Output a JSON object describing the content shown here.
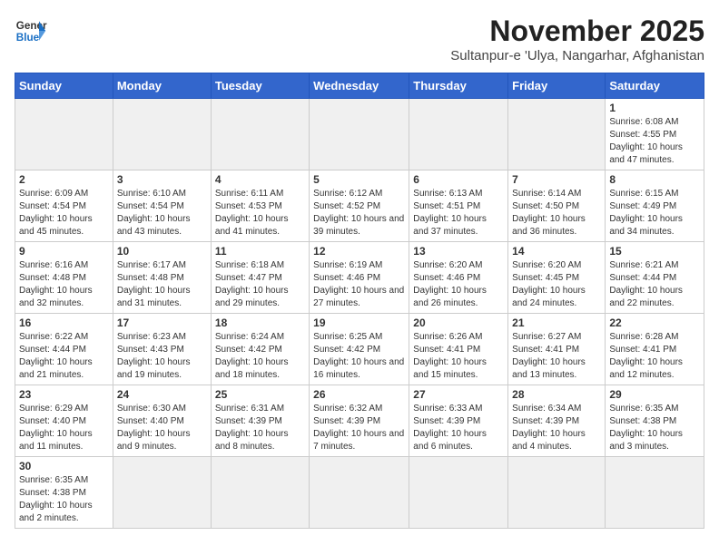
{
  "header": {
    "logo_line1": "General",
    "logo_line2": "Blue",
    "title": "November 2025",
    "subtitle": "Sultanpur-e 'Ulya, Nangarhar, Afghanistan"
  },
  "weekdays": [
    "Sunday",
    "Monday",
    "Tuesday",
    "Wednesday",
    "Thursday",
    "Friday",
    "Saturday"
  ],
  "weeks": [
    [
      {
        "day": "",
        "info": ""
      },
      {
        "day": "",
        "info": ""
      },
      {
        "day": "",
        "info": ""
      },
      {
        "day": "",
        "info": ""
      },
      {
        "day": "",
        "info": ""
      },
      {
        "day": "",
        "info": ""
      },
      {
        "day": "1",
        "info": "Sunrise: 6:08 AM\nSunset: 4:55 PM\nDaylight: 10 hours and 47 minutes."
      }
    ],
    [
      {
        "day": "2",
        "info": "Sunrise: 6:09 AM\nSunset: 4:54 PM\nDaylight: 10 hours and 45 minutes."
      },
      {
        "day": "3",
        "info": "Sunrise: 6:10 AM\nSunset: 4:54 PM\nDaylight: 10 hours and 43 minutes."
      },
      {
        "day": "4",
        "info": "Sunrise: 6:11 AM\nSunset: 4:53 PM\nDaylight: 10 hours and 41 minutes."
      },
      {
        "day": "5",
        "info": "Sunrise: 6:12 AM\nSunset: 4:52 PM\nDaylight: 10 hours and 39 minutes."
      },
      {
        "day": "6",
        "info": "Sunrise: 6:13 AM\nSunset: 4:51 PM\nDaylight: 10 hours and 37 minutes."
      },
      {
        "day": "7",
        "info": "Sunrise: 6:14 AM\nSunset: 4:50 PM\nDaylight: 10 hours and 36 minutes."
      },
      {
        "day": "8",
        "info": "Sunrise: 6:15 AM\nSunset: 4:49 PM\nDaylight: 10 hours and 34 minutes."
      }
    ],
    [
      {
        "day": "9",
        "info": "Sunrise: 6:16 AM\nSunset: 4:48 PM\nDaylight: 10 hours and 32 minutes."
      },
      {
        "day": "10",
        "info": "Sunrise: 6:17 AM\nSunset: 4:48 PM\nDaylight: 10 hours and 31 minutes."
      },
      {
        "day": "11",
        "info": "Sunrise: 6:18 AM\nSunset: 4:47 PM\nDaylight: 10 hours and 29 minutes."
      },
      {
        "day": "12",
        "info": "Sunrise: 6:19 AM\nSunset: 4:46 PM\nDaylight: 10 hours and 27 minutes."
      },
      {
        "day": "13",
        "info": "Sunrise: 6:20 AM\nSunset: 4:46 PM\nDaylight: 10 hours and 26 minutes."
      },
      {
        "day": "14",
        "info": "Sunrise: 6:20 AM\nSunset: 4:45 PM\nDaylight: 10 hours and 24 minutes."
      },
      {
        "day": "15",
        "info": "Sunrise: 6:21 AM\nSunset: 4:44 PM\nDaylight: 10 hours and 22 minutes."
      }
    ],
    [
      {
        "day": "16",
        "info": "Sunrise: 6:22 AM\nSunset: 4:44 PM\nDaylight: 10 hours and 21 minutes."
      },
      {
        "day": "17",
        "info": "Sunrise: 6:23 AM\nSunset: 4:43 PM\nDaylight: 10 hours and 19 minutes."
      },
      {
        "day": "18",
        "info": "Sunrise: 6:24 AM\nSunset: 4:42 PM\nDaylight: 10 hours and 18 minutes."
      },
      {
        "day": "19",
        "info": "Sunrise: 6:25 AM\nSunset: 4:42 PM\nDaylight: 10 hours and 16 minutes."
      },
      {
        "day": "20",
        "info": "Sunrise: 6:26 AM\nSunset: 4:41 PM\nDaylight: 10 hours and 15 minutes."
      },
      {
        "day": "21",
        "info": "Sunrise: 6:27 AM\nSunset: 4:41 PM\nDaylight: 10 hours and 13 minutes."
      },
      {
        "day": "22",
        "info": "Sunrise: 6:28 AM\nSunset: 4:41 PM\nDaylight: 10 hours and 12 minutes."
      }
    ],
    [
      {
        "day": "23",
        "info": "Sunrise: 6:29 AM\nSunset: 4:40 PM\nDaylight: 10 hours and 11 minutes."
      },
      {
        "day": "24",
        "info": "Sunrise: 6:30 AM\nSunset: 4:40 PM\nDaylight: 10 hours and 9 minutes."
      },
      {
        "day": "25",
        "info": "Sunrise: 6:31 AM\nSunset: 4:39 PM\nDaylight: 10 hours and 8 minutes."
      },
      {
        "day": "26",
        "info": "Sunrise: 6:32 AM\nSunset: 4:39 PM\nDaylight: 10 hours and 7 minutes."
      },
      {
        "day": "27",
        "info": "Sunrise: 6:33 AM\nSunset: 4:39 PM\nDaylight: 10 hours and 6 minutes."
      },
      {
        "day": "28",
        "info": "Sunrise: 6:34 AM\nSunset: 4:39 PM\nDaylight: 10 hours and 4 minutes."
      },
      {
        "day": "29",
        "info": "Sunrise: 6:35 AM\nSunset: 4:38 PM\nDaylight: 10 hours and 3 minutes."
      }
    ],
    [
      {
        "day": "30",
        "info": "Sunrise: 6:35 AM\nSunset: 4:38 PM\nDaylight: 10 hours and 2 minutes."
      },
      {
        "day": "",
        "info": ""
      },
      {
        "day": "",
        "info": ""
      },
      {
        "day": "",
        "info": ""
      },
      {
        "day": "",
        "info": ""
      },
      {
        "day": "",
        "info": ""
      },
      {
        "day": "",
        "info": ""
      }
    ]
  ]
}
